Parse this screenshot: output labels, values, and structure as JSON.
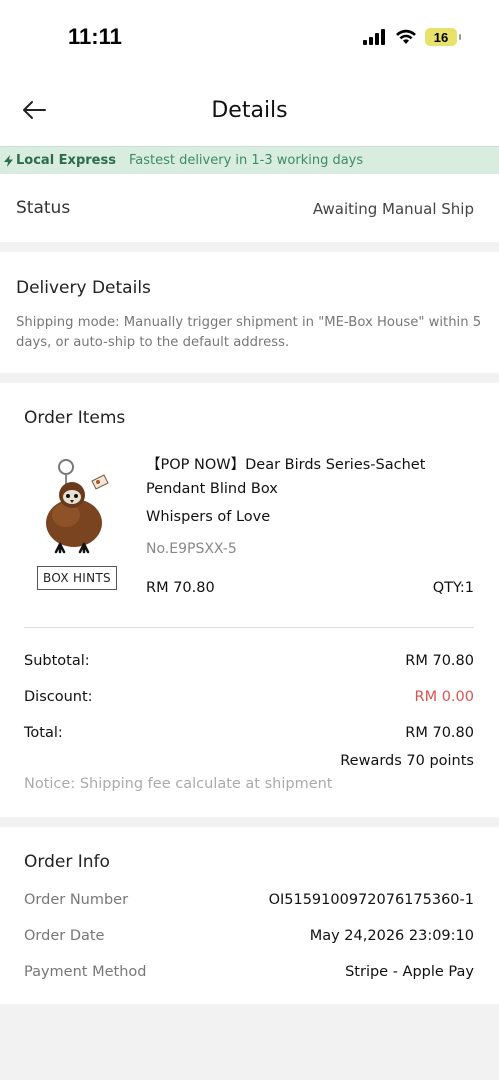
{
  "status_bar": {
    "time": "11:11",
    "battery": "16"
  },
  "header": {
    "title": "Details"
  },
  "banner": {
    "tag": "Local Express",
    "desc": "Fastest delivery in 1-3 working days"
  },
  "status": {
    "label": "Status",
    "value": "Awaiting Manual Ship"
  },
  "delivery": {
    "title": "Delivery Details",
    "text": "Shipping mode: Manually trigger shipment in \"ME-Box House\" within 5 days, or auto-ship to the default address."
  },
  "order_items": {
    "title": "Order Items",
    "items": [
      {
        "name": "【POP NOW】Dear Birds Series-Sachet Pendant Blind Box",
        "variant": "Whispers of Love",
        "sku": "No.E9PSXX-5",
        "price": "RM 70.80",
        "qty": "QTY:1",
        "hint_button": "BOX HINTS"
      }
    ],
    "summary": {
      "subtotal_label": "Subtotal:",
      "subtotal": "RM 70.80",
      "discount_label": "Discount:",
      "discount": "RM 0.00",
      "total_label": "Total:",
      "total": "RM 70.80",
      "rewards": "Rewards 70 points",
      "notice": "Notice: Shipping fee calculate at shipment"
    },
    "discount_color": "#d9534f"
  },
  "order_info": {
    "title": "Order Info",
    "rows": [
      {
        "label": "Order Number",
        "value": "OI5159100972076175360-1"
      },
      {
        "label": "Order Date",
        "value": "May 24,2026 23:09:10"
      },
      {
        "label": "Payment Method",
        "value": "Stripe - Apple Pay"
      }
    ]
  },
  "colors": {
    "banner_bg": "#d8ecdf",
    "banner_text": "#2d6b4a",
    "accent_red": "#d9534f"
  },
  "icons": {
    "back": "arrow-left-icon",
    "lightning": "lightning-icon"
  }
}
